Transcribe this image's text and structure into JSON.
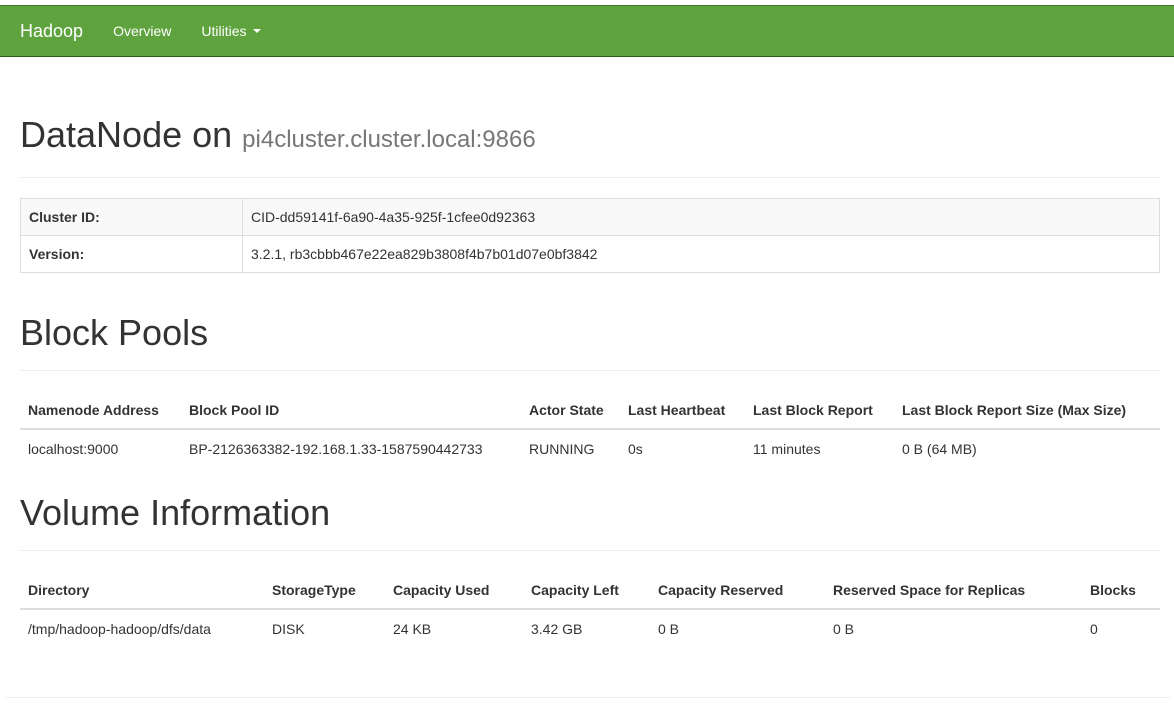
{
  "nav": {
    "brand": "Hadoop",
    "overview": "Overview",
    "utilities": "Utilities"
  },
  "header": {
    "title": "DataNode on",
    "host": "pi4cluster.cluster.local:9866"
  },
  "info": [
    {
      "label": "Cluster ID:",
      "value": "CID-dd59141f-6a90-4a35-925f-1cfee0d92363"
    },
    {
      "label": "Version:",
      "value": "3.2.1, rb3cbbb467e22ea829b3808f4b7b01d07e0bf3842"
    }
  ],
  "block_pools": {
    "title": "Block Pools",
    "columns": [
      "Namenode Address",
      "Block Pool ID",
      "Actor State",
      "Last Heartbeat",
      "Last Block Report",
      "Last Block Report Size (Max Size)"
    ],
    "rows": [
      [
        "localhost:9000",
        "BP-2126363382-192.168.1.33-1587590442733",
        "RUNNING",
        "0s",
        "11 minutes",
        "0 B (64 MB)"
      ]
    ]
  },
  "volumes": {
    "title": "Volume Information",
    "columns": [
      "Directory",
      "StorageType",
      "Capacity Used",
      "Capacity Left",
      "Capacity Reserved",
      "Reserved Space for Replicas",
      "Blocks"
    ],
    "rows": [
      [
        "/tmp/hadoop-hadoop/dfs/data",
        "DISK",
        "24 KB",
        "3.42 GB",
        "0 B",
        "0 B",
        "0"
      ]
    ]
  },
  "colors": {
    "navbar": "#5fa33e"
  }
}
